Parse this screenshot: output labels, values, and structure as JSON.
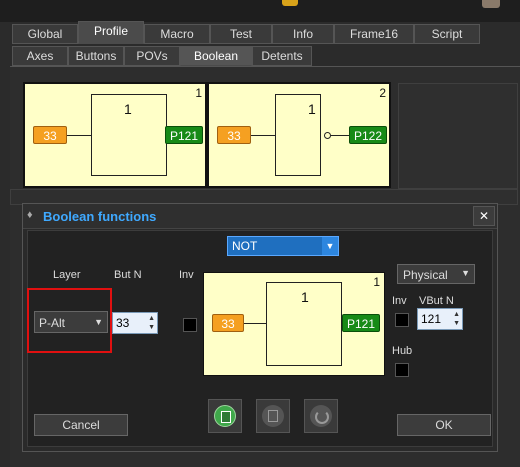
{
  "tabs_main": [
    "Global",
    "Profile",
    "Macro",
    "Test",
    "Info",
    "Frame16",
    "Script"
  ],
  "tabs_sub": [
    "Axes",
    "Buttons",
    "POVs",
    "Boolean",
    "Detents"
  ],
  "cells": [
    {
      "number": "1",
      "gate_number": "1",
      "input": "33",
      "output": "P121",
      "inverted": false
    },
    {
      "number": "2",
      "gate_number": "1",
      "input": "33",
      "output": "P122",
      "inverted": true
    }
  ],
  "dialog": {
    "title": "Boolean functions",
    "close_label": "✕",
    "function_select": "NOT",
    "labels": {
      "layer": "Layer",
      "butn": "But N",
      "inv_left": "Inv",
      "inv_right": "Inv",
      "vbutn": "VBut N",
      "hub": "Hub"
    },
    "layer_select": "P-Alt",
    "butn_value": "33",
    "physical_select": "Physical",
    "vbutn_value": "121",
    "preview": {
      "number": "1",
      "gate_number": "1",
      "input": "33",
      "output": "P121"
    },
    "cancel_label": "Cancel",
    "ok_label": "OK"
  },
  "icons": {
    "paste": "paste-icon",
    "copy": "copy-icon",
    "reset": "undo-icon"
  },
  "colors": {
    "accent": "#3fa9ff",
    "input_pill": "#f5a021",
    "output_pill": "#178a17",
    "cell_bg": "#ffffc8",
    "highlight": "#e01010"
  }
}
